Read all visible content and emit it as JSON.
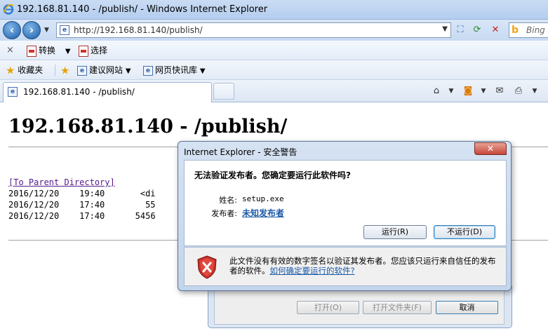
{
  "window": {
    "title": "192.168.81.140 - /publish/ - Windows Internet Explorer"
  },
  "address_bar": {
    "url": "http://192.168.81.140/publish/",
    "search_placeholder": "Bing"
  },
  "command_bar": {
    "close_label": "×",
    "convert_label": "转换",
    "select_label": "选择"
  },
  "favorites_bar": {
    "favorites_label": "收藏夹",
    "suggested_sites_label": "建议网站",
    "web_slices_label": "网页快讯库"
  },
  "tabs": [
    {
      "label": "192.168.81.140 - /publish/"
    }
  ],
  "page": {
    "heading": "192.168.81.140 - /publish/",
    "parent_link": "[To Parent Directory]",
    "listing": [
      {
        "date": "2016/12/20",
        "time": "19:40",
        "info": "<di"
      },
      {
        "date": "2016/12/20",
        "time": "17:40",
        "info": "55"
      },
      {
        "date": "2016/12/20",
        "time": "17:40",
        "info": "5456"
      }
    ]
  },
  "security_dialog": {
    "title": "Internet Explorer - 安全警告",
    "question": "无法验证发布者。您确定要运行此软件吗?",
    "name_label": "姓名:",
    "name_value": "setup.exe",
    "publisher_label": "发布者:",
    "publisher_value": "未知发布者",
    "run_button": "运行(R)",
    "dont_run_button": "不运行(D)",
    "footer_text": "此文件没有有效的数字签名以验证其发布者。您应该只运行来自信任的发布者的软件。",
    "footer_link": "如何确定要运行的软件?"
  },
  "download_dialog": {
    "open_button": "打开(O)",
    "open_folder_button": "打开文件夹(F)",
    "cancel_button": "取消"
  },
  "colors": {
    "accent": "#1c5aa8",
    "visited_link": "#551a8b",
    "warning_red": "#c7302a"
  }
}
